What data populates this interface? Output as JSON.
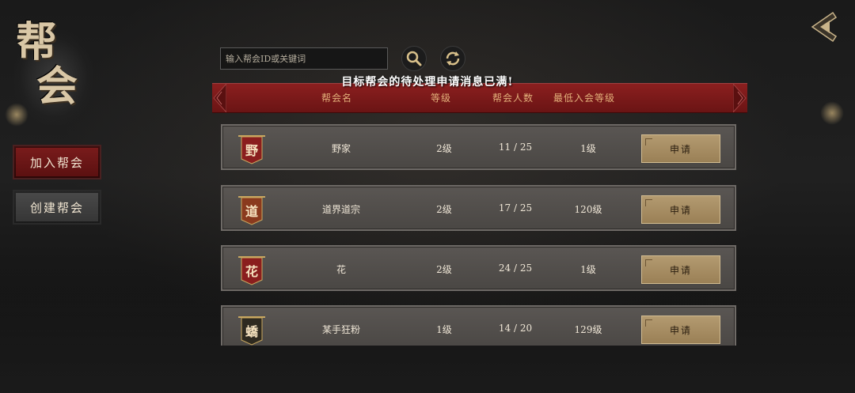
{
  "screen": {
    "title_chars": [
      "帮",
      "会"
    ],
    "notice": "目标帮会的待处理申请消息已满!"
  },
  "sidebar": {
    "items": [
      {
        "label": "加入帮会",
        "active": true
      },
      {
        "label": "创建帮会",
        "active": false
      }
    ]
  },
  "search": {
    "placeholder": "输入帮会ID或关键词",
    "search_icon": "search-icon",
    "refresh_icon": "refresh-icon"
  },
  "table": {
    "headers": {
      "name": "帮会名",
      "level": "等级",
      "members": "帮会人数",
      "min_level": "最低入会等级"
    },
    "rows": [
      {
        "emblem": "野",
        "name": "野家",
        "level": "2级",
        "members": "11 / 25",
        "min_level": "1级",
        "action": "申请",
        "emblem_color": "#8a1e1e"
      },
      {
        "emblem": "道",
        "name": "道界道宗",
        "level": "2级",
        "members": "17 / 25",
        "min_level": "120级",
        "action": "申请",
        "emblem_color": "#8a3a1e"
      },
      {
        "emblem": "花",
        "name": "花",
        "level": "2级",
        "members": "24 / 25",
        "min_level": "1级",
        "action": "申请",
        "emblem_color": "#8a1e1e"
      },
      {
        "emblem": "蟜",
        "name": "某手狂粉",
        "level": "1级",
        "members": "14 / 20",
        "min_level": "129级",
        "action": "申请",
        "emblem_color": "#2e2a20"
      }
    ]
  },
  "colors": {
    "accent_red": "#7a1c1c",
    "header_text": "#e2b07a",
    "button_gold": "#b39a70"
  }
}
